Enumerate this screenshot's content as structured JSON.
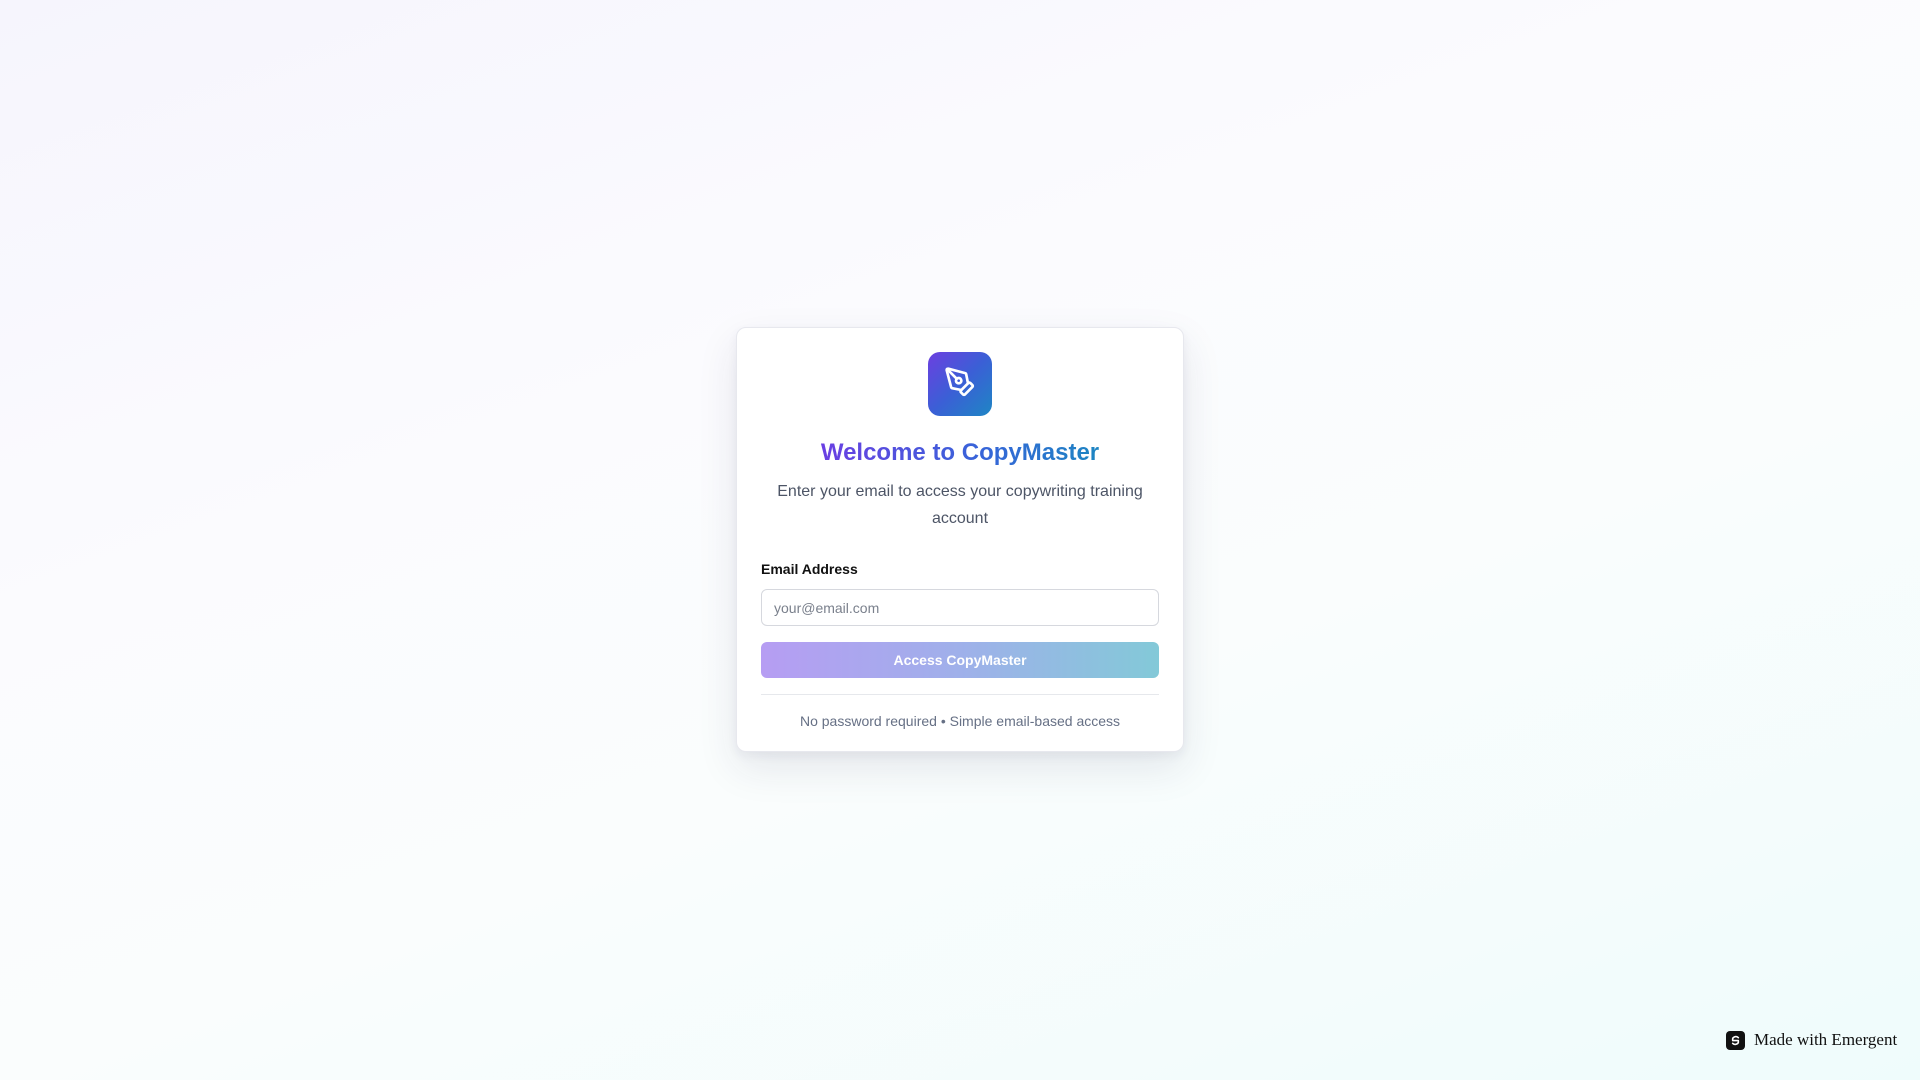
{
  "app": {
    "name": "CopyMaster",
    "accent_colors": [
      "#6a3fe3",
      "#3566d8",
      "#1d85c2"
    ]
  },
  "login_card": {
    "logo_icon": "pen-tool-icon",
    "title": "Welcome to CopyMaster",
    "subtitle": "Enter your email to access your copywriting training account",
    "email_label": "Email Address",
    "email_value": "",
    "email_placeholder": "your@email.com",
    "submit_label": "Access CopyMaster",
    "footnote": "No password required • Simple email-based access"
  },
  "badge": {
    "icon": "emergent-logo-icon",
    "label": "Made with Emergent"
  }
}
